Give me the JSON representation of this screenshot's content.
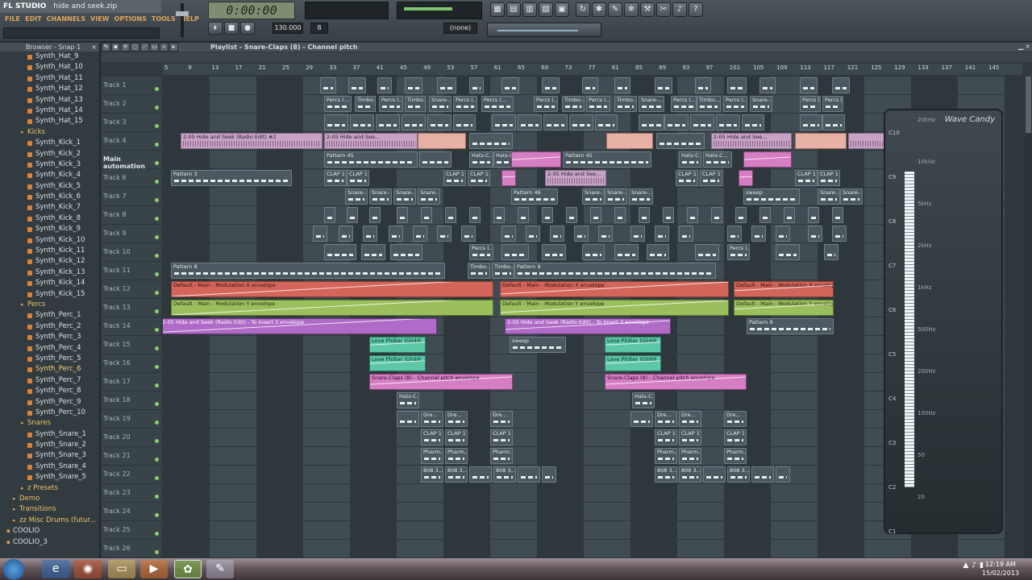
{
  "app": {
    "brand": "FL STUDIO",
    "project_title": "hide and seek.zip",
    "menus": [
      "FILE",
      "EDIT",
      "CHANNELS",
      "VIEW",
      "OPTIONS",
      "TOOLS",
      "HELP"
    ]
  },
  "transport": {
    "time": "0:00:00",
    "tempo": "130.000",
    "pattern": "8",
    "snap": "(none)",
    "buttons": [
      "⏵",
      "■",
      "●"
    ]
  },
  "toolbar": {
    "tools_a": [
      "▦",
      "▤",
      "▥",
      "▧",
      "▣",
      "◫"
    ],
    "tools_b": [
      "↻",
      "✱",
      "✎",
      "❄",
      "⚒",
      "✂",
      "♪",
      "?"
    ]
  },
  "browser": {
    "title": "Browser - Snap 1",
    "close": "×",
    "items": [
      {
        "label": "Synth_Hat_9",
        "type": "file"
      },
      {
        "label": "Synth_Hat_10",
        "type": "file"
      },
      {
        "label": "Synth_Hat_11",
        "type": "file"
      },
      {
        "label": "Synth_Hat_12",
        "type": "file"
      },
      {
        "label": "Synth_Hat_13",
        "type": "file"
      },
      {
        "label": "Synth_Hat_14",
        "type": "file"
      },
      {
        "label": "Synth_Hat_15",
        "type": "file"
      },
      {
        "label": "Kicks",
        "type": "folder"
      },
      {
        "label": "Synth_Kick_1",
        "type": "file"
      },
      {
        "label": "Synth_Kick_2",
        "type": "file"
      },
      {
        "label": "Synth_Kick_3",
        "type": "file"
      },
      {
        "label": "Synth_Kick_4",
        "type": "file"
      },
      {
        "label": "Synth_Kick_5",
        "type": "file"
      },
      {
        "label": "Synth_Kick_6",
        "type": "file"
      },
      {
        "label": "Synth_Kick_7",
        "type": "file"
      },
      {
        "label": "Synth_Kick_8",
        "type": "file"
      },
      {
        "label": "Synth_Kick_9",
        "type": "file"
      },
      {
        "label": "Synth_Kick_10",
        "type": "file"
      },
      {
        "label": "Synth_Kick_11",
        "type": "file"
      },
      {
        "label": "Synth_Kick_12",
        "type": "file"
      },
      {
        "label": "Synth_Kick_13",
        "type": "file"
      },
      {
        "label": "Synth_Kick_14",
        "type": "file"
      },
      {
        "label": "Synth_Kick_15",
        "type": "file"
      },
      {
        "label": "Percs",
        "type": "folder"
      },
      {
        "label": "Synth_Perc_1",
        "type": "file"
      },
      {
        "label": "Synth_Perc_2",
        "type": "file"
      },
      {
        "label": "Synth_Perc_3",
        "type": "file"
      },
      {
        "label": "Synth_Perc_4",
        "type": "file"
      },
      {
        "label": "Synth_Perc_5",
        "type": "file"
      },
      {
        "label": "Synth_Perc_6",
        "type": "selected"
      },
      {
        "label": "Synth_Perc_7",
        "type": "file"
      },
      {
        "label": "Synth_Perc_8",
        "type": "file"
      },
      {
        "label": "Synth_Perc_9",
        "type": "file"
      },
      {
        "label": "Synth_Perc_10",
        "type": "file"
      },
      {
        "label": "Snares",
        "type": "folder"
      },
      {
        "label": "Synth_Snare_1",
        "type": "file"
      },
      {
        "label": "Synth_Snare_2",
        "type": "file"
      },
      {
        "label": "Synth_Snare_3",
        "type": "file"
      },
      {
        "label": "Synth_Snare_4",
        "type": "file"
      },
      {
        "label": "Synth_Snare_5",
        "type": "file"
      },
      {
        "label": "z Presets",
        "type": "folder"
      },
      {
        "label": "Demo",
        "type": "root"
      },
      {
        "label": "Transitions",
        "type": "root"
      },
      {
        "label": "zz Misc Drums (futur...",
        "type": "root"
      },
      {
        "label": "COOLIO",
        "type": "root2"
      },
      {
        "label": "COOLIO_3",
        "type": "root2"
      }
    ]
  },
  "playlist": {
    "title": "Playlist - Snare-Claps (8) - Channel pitch",
    "ruler": [
      "5",
      "9",
      "13",
      "17",
      "21",
      "25",
      "29",
      "33",
      "37",
      "41",
      "45",
      "49",
      "53",
      "57",
      "61",
      "65",
      "69",
      "73",
      "77",
      "81",
      "85",
      "89",
      "93",
      "97",
      "101",
      "105",
      "109",
      "113",
      "117",
      "121",
      "125",
      "129",
      "133",
      "137",
      "141",
      "145"
    ],
    "tracks": [
      "Track 1",
      "Track 2",
      "Track 3",
      "Track 4",
      "Main automation",
      "Track 6",
      "Track 7",
      "Track 8",
      "Track 9",
      "Track 10",
      "Track 11",
      "Track 12",
      "Track 13",
      "Track 14",
      "Track 15",
      "Track 16",
      "Track 17",
      "Track 18",
      "Track 19",
      "Track 20",
      "Track 21",
      "Track 22",
      "Track 23",
      "Track 24",
      "Track 25",
      "Track 26"
    ],
    "clips": {
      "audio_a": "2-05 Hide and Seek (Radio Edit) #2",
      "audio_b": "2-05 Hide and See...",
      "pattern45": "Pattern 45",
      "pattern46": "Pattern 46",
      "pattern3": "Pattern 3",
      "pattern8": "Pattern 8",
      "pattern9": "Pattern 9",
      "clap": "CLAP 1",
      "snare": "Snare-...",
      "percs": "Percs (...",
      "timbo": "Timbo...",
      "hats": "Hats-C...",
      "main_x": "Default - Main - Modulation X envelope",
      "main_y": "Default - Main - Modulation Y envelope",
      "insert": "2-05 Hide and Seek (Radio Edit) - To Insert 3 envelope",
      "lowpass": "Love Philter (Gliddi...",
      "snareclaps": "Snare-Claps (8) - Channel pitch envelope",
      "sweep": "sweep",
      "dream": "Dre...",
      "pharm": "Pharm...",
      "b808": "808 3..."
    }
  },
  "wavecandy": {
    "title": "Wave Candy",
    "notes": [
      "C10",
      "C9",
      "C8",
      "C7",
      "C6",
      "C5",
      "C4",
      "C3",
      "C2",
      "C1"
    ],
    "freqs": [
      "20kHz",
      "10kHz",
      "5kHz",
      "2kHz",
      "1kHz",
      "500Hz",
      "200Hz",
      "100Hz",
      "50",
      "20"
    ]
  },
  "taskbar": {
    "time": "12:19 AM",
    "date": "15/02/2013"
  }
}
